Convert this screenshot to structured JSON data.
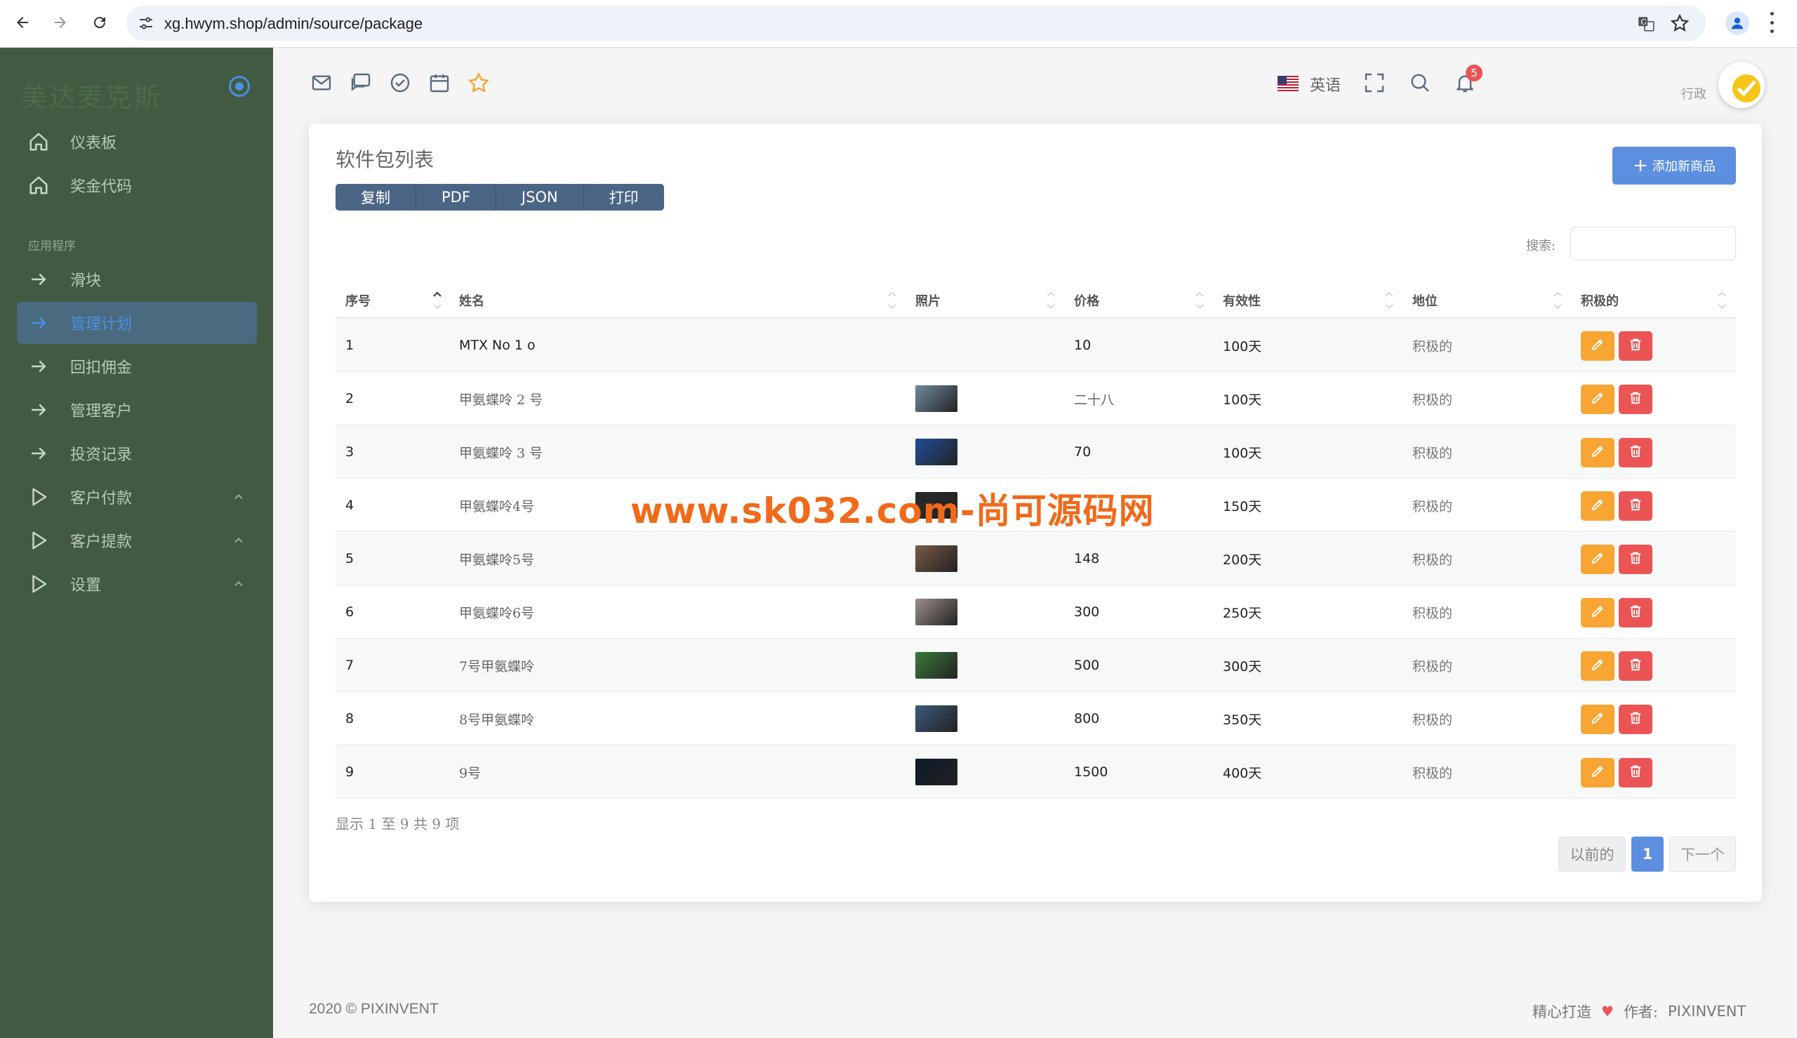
{
  "browser": {
    "url": "xg.hwym.shop/admin/source/package"
  },
  "sidebar": {
    "brand": "美达麦克斯",
    "section_label": "应用程序",
    "items": [
      {
        "label": "仪表板",
        "icon": "home-icon"
      },
      {
        "label": "奖金代码",
        "icon": "home-icon"
      },
      {
        "label": "滑块",
        "icon": "arrow-right-icon"
      },
      {
        "label": "管理计划",
        "icon": "arrow-right-icon",
        "active": true
      },
      {
        "label": "回扣佣金",
        "icon": "arrow-right-icon"
      },
      {
        "label": "管理客户",
        "icon": "arrow-right-icon"
      },
      {
        "label": "投资记录",
        "icon": "arrow-right-icon"
      },
      {
        "label": "客户付款",
        "icon": "play-icon",
        "expandable": true
      },
      {
        "label": "客户提款",
        "icon": "play-icon",
        "expandable": true
      },
      {
        "label": "设置",
        "icon": "play-icon",
        "expandable": true
      }
    ]
  },
  "header": {
    "language": "英语",
    "notification_count": "5",
    "user_role": "行政"
  },
  "card": {
    "title": "软件包列表",
    "export_buttons": [
      "复制",
      "PDF",
      "JSON",
      "打印"
    ],
    "add_button": "添加新商品",
    "search_label": "搜索:",
    "search_value": ""
  },
  "table": {
    "columns": [
      "序号",
      "姓名",
      "照片",
      "价格",
      "有效性",
      "地位",
      "积极的"
    ],
    "rows": [
      {
        "no": "1",
        "name": "MTX No 1 o",
        "price": "10",
        "validity": "100天",
        "status": "积极的",
        "thumb": ""
      },
      {
        "no": "2",
        "name": "甲氨蝶呤 2 号",
        "price": "二十八",
        "validity": "100天",
        "status": "积极的",
        "thumb": "#6f8aa0"
      },
      {
        "no": "3",
        "name": "甲氨蝶呤 3 号",
        "price": "70",
        "validity": "100天",
        "status": "积极的",
        "thumb": "#1f4f9a"
      },
      {
        "no": "4",
        "name": "甲氨蝶呤4号",
        "price": "",
        "validity": "150天",
        "status": "积极的",
        "thumb": "#2a2a2a"
      },
      {
        "no": "5",
        "name": "甲氨蝶呤5号",
        "price": "148",
        "validity": "200天",
        "status": "积极的",
        "thumb": "#7a5a46"
      },
      {
        "no": "6",
        "name": "甲氨蝶呤6号",
        "price": "300",
        "validity": "250天",
        "status": "积极的",
        "thumb": "#9b8f8a"
      },
      {
        "no": "7",
        "name": "7号甲氨蝶呤",
        "price": "500",
        "validity": "300天",
        "status": "积极的",
        "thumb": "#3a7a3a"
      },
      {
        "no": "8",
        "name": "8号甲氨蝶呤",
        "price": "800",
        "validity": "350天",
        "status": "积极的",
        "thumb": "#3b5a7a"
      },
      {
        "no": "9",
        "name": "9号",
        "price": "1500",
        "validity": "400天",
        "status": "积极的",
        "thumb": "#0f1a2a"
      }
    ]
  },
  "pagination": {
    "info": "显示 1 至 9 共 9 项",
    "prev": "以前的",
    "current": "1",
    "next": "下一个"
  },
  "watermark": "www.sk032.com-尚可源码网",
  "footer": {
    "copyright": "2020 © PIXINVENT",
    "crafted": "精心打造",
    "author_label": "作者:",
    "author": "PIXINVENT"
  },
  "colors": {
    "sidebar_bg": "#415a41",
    "accent": "#5d8fe0",
    "edit": "#f8a533",
    "delete": "#ea5455",
    "watermark": "#f06a1a"
  }
}
